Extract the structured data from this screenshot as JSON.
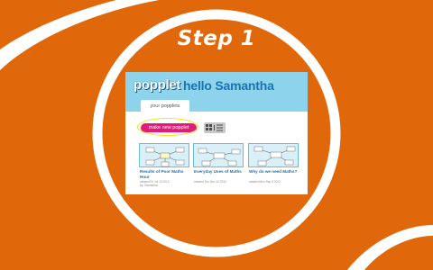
{
  "slide": {
    "title": "Step 1",
    "background_color": "#e0680a",
    "ring_color": "#ffffff"
  },
  "app": {
    "brand": "popplet",
    "greeting": "hello Samantha",
    "header_color": "#8ed3ec",
    "tabs": [
      {
        "label": "your popplets"
      }
    ],
    "make_new_button": "make new popplet",
    "make_new_color": "#e6197a",
    "highlight_color": "#f5e20c",
    "view_toggle": {
      "grid_icon": "grid-icon",
      "list_icon": "list-icon"
    },
    "popplets": [
      {
        "title": "Results of Poor Maths Hour",
        "meta": "created Fri Jul 13 2012\nby: Samantha"
      },
      {
        "title": "Everyday Uses of Maths",
        "meta": "created Thu Dec 10 2012"
      },
      {
        "title": "Why do we need Maths?",
        "meta": "created Mon Sep 3 2012"
      }
    ]
  }
}
